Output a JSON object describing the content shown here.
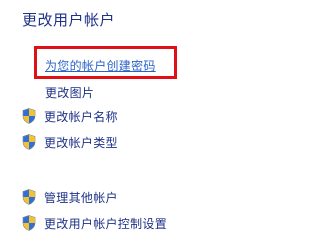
{
  "heading": "更改用户帐户",
  "tasks": [
    {
      "label": "为您的帐户创建密码",
      "icon": "",
      "style": "link"
    },
    {
      "label": "更改图片",
      "icon": "",
      "style": "plain"
    },
    {
      "label": "更改帐户名称",
      "icon": "uac-shield-icon",
      "style": "shield"
    },
    {
      "label": "更改帐户类型",
      "icon": "uac-shield-icon",
      "style": "shield"
    },
    {
      "label": "管理其他帐户",
      "icon": "uac-shield-icon",
      "style": "shield"
    },
    {
      "label": "更改用户帐户控制设置",
      "icon": "uac-shield-icon",
      "style": "shield"
    }
  ],
  "colors": {
    "heading": "#1e3287",
    "link": "#2a63c6",
    "highlight_box": "#e01017"
  }
}
